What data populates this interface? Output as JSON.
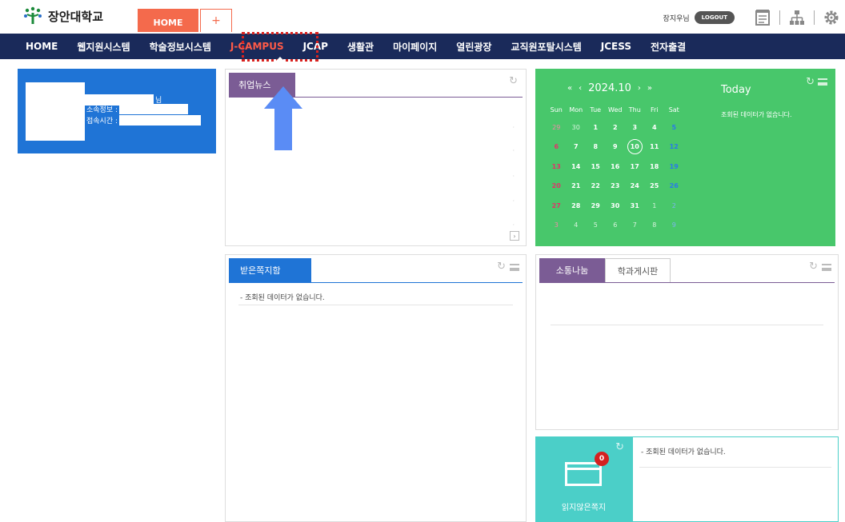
{
  "topbar": {
    "logo_text": "장안대학교",
    "tab_home": "HOME",
    "tab_add": "+",
    "user_name": "장지우님",
    "logout_label": "LOGOUT"
  },
  "nav": {
    "items": [
      "HOME",
      "웹지원시스템",
      "학술정보시스템",
      "J-CAMPUS",
      "JCAP",
      "생활관",
      "마이페이지",
      "열린광장",
      "교직원포탈시스템",
      "JCESS",
      "전자출결"
    ],
    "active_index": 3
  },
  "profile": {
    "name_suffix": "님",
    "dept_label": "소속정보 :",
    "login_label": "접속시간 :"
  },
  "job_panel": {
    "tab_label": "취업뉴스"
  },
  "received_panel": {
    "tab_label": "받은쪽지함",
    "empty_text": "- 조회된 데이터가 없습니다."
  },
  "community_panel": {
    "tab_active": "소통나눔",
    "tab_inactive": "학과게시판"
  },
  "calendar": {
    "month_label": "2024.10",
    "today_label": "Today",
    "empty_text": "조회된 데이터가 없습니다.",
    "weekdays": [
      "Sun",
      "Mon",
      "Tue",
      "Wed",
      "Thu",
      "Fri",
      "Sat"
    ],
    "weeks": [
      [
        "29",
        "30",
        "1",
        "2",
        "3",
        "4",
        "5"
      ],
      [
        "6",
        "7",
        "8",
        "9",
        "10",
        "11",
        "12"
      ],
      [
        "13",
        "14",
        "15",
        "16",
        "17",
        "18",
        "19"
      ],
      [
        "20",
        "21",
        "22",
        "23",
        "24",
        "25",
        "26"
      ],
      [
        "27",
        "28",
        "29",
        "30",
        "31",
        "1",
        "2"
      ],
      [
        "3",
        "4",
        "5",
        "6",
        "7",
        "8",
        "9"
      ]
    ],
    "today_date": "10"
  },
  "unread": {
    "label": "읽지않은쪽지",
    "count": "0",
    "empty_text": "- 조회된 데이터가 없습니다."
  },
  "colors": {
    "nav_bg": "#1a2a5a",
    "accent_orange": "#f46a4c",
    "profile_blue": "#1f74d6",
    "calendar_green": "#48c76b",
    "purple_tab": "#7b5c95",
    "teal": "#4bcfc8",
    "highlight_red": "#d9221f",
    "arrow_blue": "#5a8cf5"
  }
}
